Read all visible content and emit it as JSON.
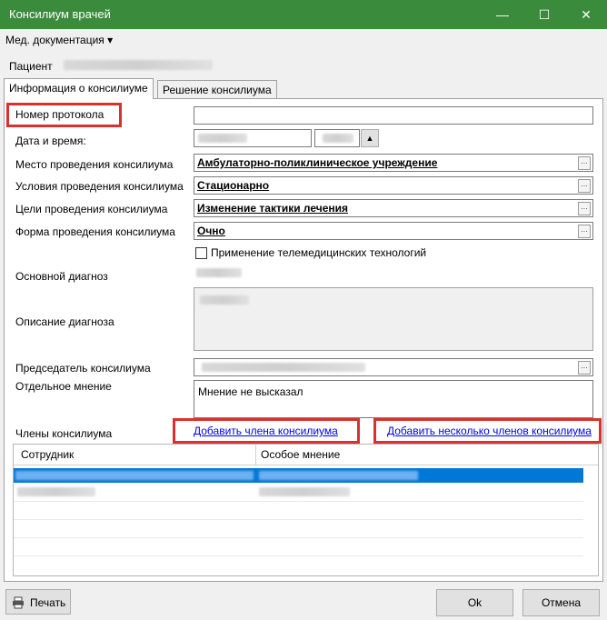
{
  "window": {
    "title": "Консилиум врачей",
    "minimize": "—",
    "maximize": "☐",
    "close": "✕",
    "accent": "#3a8b3c"
  },
  "menu": {
    "med_docs": "Мед. документация ▾"
  },
  "patient": {
    "label": "Пациент"
  },
  "tabs": [
    {
      "label": "Информация о консилиуме",
      "active": true
    },
    {
      "label": "Решение консилиума",
      "active": false
    }
  ],
  "form": {
    "protocol_number": {
      "label": "Номер протокола",
      "value": ""
    },
    "datetime": {
      "label": "Дата и время:"
    },
    "place": {
      "label": "Место проведения консилиума",
      "value": "Амбулаторно-поликлиническое учреждение"
    },
    "conditions": {
      "label": "Условия проведения консилиума",
      "value": "Стационарно"
    },
    "goals": {
      "label": "Цели проведения консилиума",
      "value": "Изменение тактики лечения"
    },
    "form_type": {
      "label": "Форма проведения консилиума",
      "value": "Очно"
    },
    "telemed": {
      "label": "Применение телемедицинских технологий",
      "checked": false
    },
    "main_diagnosis": {
      "label": "Основной диагноз"
    },
    "diagnosis_description": {
      "label": "Описание диагноза"
    },
    "chairman": {
      "label": "Председатель консилиума"
    },
    "separate_opinion": {
      "label": "Отдельное мнение",
      "value": "Мнение не высказал"
    },
    "members": {
      "label": "Члены консилиума"
    },
    "add_member_link": "Добавить члена консилиума",
    "add_several_link": "Добавить несколько членов консилиума",
    "dots": "..."
  },
  "members_table": {
    "columns": [
      "Сотрудник",
      "Особое мнение"
    ],
    "selection_color": "#0078d7"
  },
  "buttons": {
    "print": "Печать",
    "ok": "Ok",
    "cancel": "Отмена"
  },
  "highlight_color": "#d9322e"
}
